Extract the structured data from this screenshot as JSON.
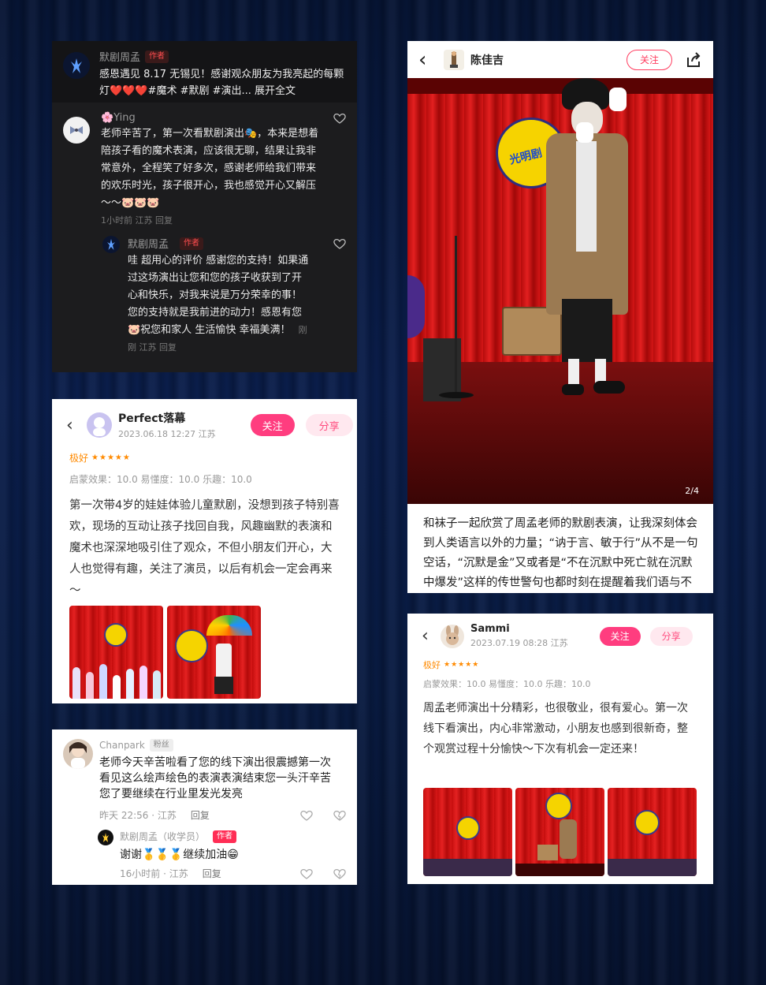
{
  "card1": {
    "author": "默剧周孟",
    "author_tag": "作者",
    "post_text": "感恩遇见 8.17 无锡见！感谢观众朋友为我亮起的每颗灯❤️❤️❤️#魔术 #默剧 #演出... 展开全文",
    "comment": {
      "user": "🌸Ying",
      "text": "老师辛苦了，第一次看默剧演出🎭，本来是想着陪孩子看的魔术表演，应该很无聊，结果让我非常意外，全程笑了好多次，感谢老师给我们带来的欢乐时光，孩子很开心，我也感觉开心又解压～～🐷🐷🐷",
      "meta": "1小时前 江苏 回复"
    },
    "reply": {
      "user": "默剧周孟",
      "tag": "作者",
      "text": "哇 超用心的评价 感谢您的支持！如果通过这场演出让您和您的孩子收获到了开心和快乐，对我来说是万分荣幸的事！您的支持就是我前进的动力！感恩有您🐷祝您和家人 生活愉快 幸福美满！",
      "meta": "刚刚 江苏 回复"
    }
  },
  "card2": {
    "user": "Perfect落幕",
    "date": "2023.06.18 12:27 江苏",
    "follow": "关注",
    "share": "分享",
    "rating_label": "极好",
    "stars": "★★★★★",
    "scores": "启蒙效果：10.0 易懂度：10.0 乐趣：10.0",
    "text": "第一次带4岁的娃娃体验儿童默剧，没想到孩子特别喜欢，现场的互动让孩子找回自我，风趣幽默的表演和魔术也深深地吸引住了观众，不但小朋友们开心，大人也觉得有趣，关注了演员，以后有机会一定会再来～"
  },
  "card3": {
    "user": "Chanpark",
    "user_tag": "粉丝",
    "text": "老师今天辛苦啦看了您的线下演出很震撼第一次看见这么绘声绘色的表演表演结束您一头汗辛苦您了要继续在行业里发光发亮",
    "time": "昨天 22:56 · 江苏",
    "reply_label": "回复",
    "reply": {
      "user": "默剧周孟（收学员）",
      "tag": "作者",
      "text": "谢谢🥇🥇🥇继续加油😁",
      "time": "16小时前 · 江苏",
      "reply_label": "回复"
    }
  },
  "card4": {
    "user": "陈佳吉",
    "follow": "关注",
    "page_indicator": "2/4",
    "logo_text": "光明剧",
    "text": "和袜子一起欣赏了周孟老师的默剧表演，让我深刻体会到人类语言以外的力量；“讷于言、敏于行”从不是一句空话，“沉默是金”又或者是“不在沉默中死亡就在沉默中爆发”这样的传世警句也都时刻在提醒着我们语与不语间的辩证力量，默剧精彩、发人深省。😶😶👍"
  },
  "card5": {
    "user": "Sammi",
    "date": "2023.07.19 08:28 江苏",
    "follow": "关注",
    "share": "分享",
    "rating_label": "极好",
    "stars": "★★★★★",
    "scores": "启蒙效果：10.0 易懂度：10.0 乐趣：10.0",
    "text": "周孟老师演出十分精彩，也很敬业，很有爱心。第一次线下看演出，内心非常激动，小朋友也感到很新奇，整个观赏过程十分愉快～下次有机会一定还来！"
  },
  "colors": {
    "accent_pink": "#ff3d7f",
    "star_orange": "#ff8a00",
    "tag_red": "#ff2d55"
  }
}
